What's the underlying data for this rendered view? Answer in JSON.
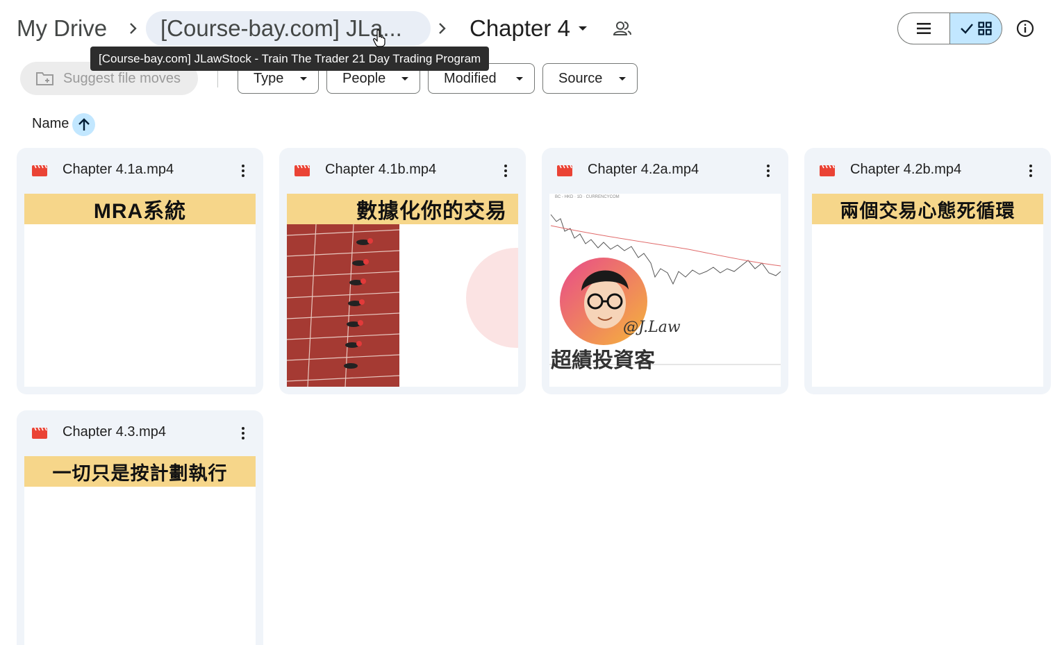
{
  "breadcrumb": {
    "root": "My Drive",
    "parent": "[Course-bay.com] JLa...",
    "current": "Chapter 4"
  },
  "tooltip": "[Course-bay.com] JLawStock - Train The Trader 21 Day Trading Program",
  "filters": {
    "suggest": "Suggest file moves",
    "type": "Type",
    "people": "People",
    "modified": "Modified",
    "source": "Source"
  },
  "sort": {
    "label": "Name",
    "direction": "ascending"
  },
  "view": {
    "mode": "grid"
  },
  "colors": {
    "accent": "#c2e7ff",
    "card_bg": "#f0f4f9",
    "video_icon": "#ea4335",
    "banner": "#f6d68a"
  },
  "files": [
    {
      "name": "Chapter 4.1a.mp4",
      "banner": "MRA系統"
    },
    {
      "name": "Chapter 4.1b.mp4",
      "banner": "數據化你的交易"
    },
    {
      "name": "Chapter 4.2a.mp4",
      "banner": "",
      "overlay_text": "超績投資客",
      "signature": "@J.Law"
    },
    {
      "name": "Chapter 4.2b.mp4",
      "banner": "兩個交易心態死循環"
    },
    {
      "name": "Chapter 4.3.mp4",
      "banner": "一切只是按計劃執行"
    }
  ],
  "chart_header_text": "BC - HKD · 1D · CURRENCYCOM"
}
